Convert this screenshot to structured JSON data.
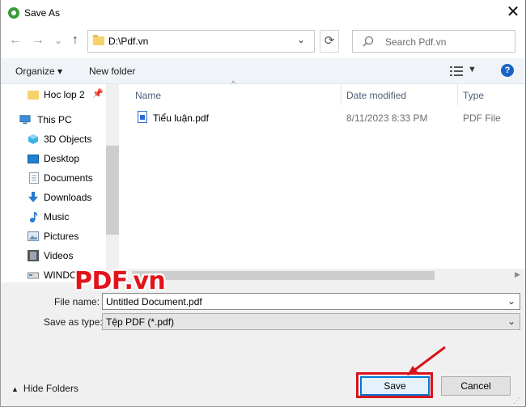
{
  "window": {
    "title": "Save As",
    "close_glyph": "✕"
  },
  "address": {
    "path": "D:\\Pdf.vn",
    "search_placeholder": "Search Pdf.vn"
  },
  "nav_buttons": {
    "back": "←",
    "forward": "→",
    "recent": "⌄",
    "up": "↑",
    "refresh": "⟳"
  },
  "toolbar": {
    "organize": "Organize ▾",
    "new_folder": "New folder",
    "help": "?"
  },
  "sidebar": {
    "items": [
      {
        "label": "Hoc lop 2",
        "icon": "folder-icon",
        "color": "#f6d26b",
        "pinned": true
      },
      {
        "label": "This PC",
        "icon": "computer-icon",
        "color": "#3c8fd6"
      },
      {
        "label": "3D Objects",
        "icon": "3d-objects-icon",
        "color": "#3fb2e8"
      },
      {
        "label": "Desktop",
        "icon": "desktop-icon",
        "color": "#1f80d4"
      },
      {
        "label": "Documents",
        "icon": "documents-icon",
        "color": "#8e9aa8"
      },
      {
        "label": "Downloads",
        "icon": "downloads-icon",
        "color": "#2a7bd0"
      },
      {
        "label": "Music",
        "icon": "music-icon",
        "color": "#2a7bd0"
      },
      {
        "label": "Pictures",
        "icon": "pictures-icon",
        "color": "#6f8fb0"
      },
      {
        "label": "Videos",
        "icon": "videos-icon",
        "color": "#555555"
      },
      {
        "label": "WINDO",
        "icon": "drive-icon",
        "color": "#888888"
      }
    ]
  },
  "columns": [
    "Name",
    "Date modified",
    "Type"
  ],
  "files": [
    {
      "name": "Tiểu luận.pdf",
      "date": "8/11/2023 8:33 PM",
      "type": "PDF File"
    }
  ],
  "form": {
    "file_name_label": "File name:",
    "file_name_value": "Untitled Document.pdf",
    "save_type_label": "Save as type:",
    "save_type_value": "Tệp PDF (*.pdf)"
  },
  "footer": {
    "hide_folders": "Hide Folders",
    "save": "Save",
    "cancel": "Cancel"
  },
  "watermark": "PDF.vn",
  "colors": {
    "accent": "#0078d7",
    "highlight": "#d8141c",
    "watermark": "#e2141b"
  }
}
